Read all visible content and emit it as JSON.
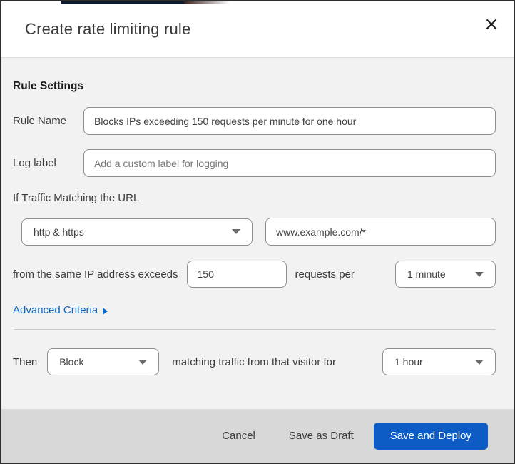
{
  "window": {
    "title": "Create rate limiting rule",
    "close_glyph": "×"
  },
  "form": {
    "section_heading": "Rule Settings",
    "rule_name": {
      "label": "Rule Name",
      "value": "Blocks IPs exceeding 150 requests per minute for one hour"
    },
    "log_label": {
      "label": "Log label",
      "placeholder": "Add a custom label for logging"
    },
    "traffic_match": {
      "heading": "If Traffic Matching the URL",
      "scheme_selected": "http & https",
      "url_value": "www.example.com/*"
    },
    "threshold": {
      "prefix": "from the same IP address exceeds",
      "requests_value": "150",
      "middle": "requests per",
      "period_selected": "1 minute"
    },
    "advanced_criteria_label": "Advanced Criteria"
  },
  "action": {
    "then_label": "Then",
    "action_selected": "Block",
    "middle": "matching traffic from that visitor for",
    "duration_selected": "1 hour"
  },
  "footer": {
    "cancel_label": "Cancel",
    "save_draft_label": "Save as Draft",
    "save_deploy_label": "Save and Deploy"
  },
  "colors": {
    "primary_button": "#0d5cc5",
    "link": "#0d65c8",
    "body_bg": "#f2f2f2",
    "footer_bg": "#d8d8d8"
  }
}
